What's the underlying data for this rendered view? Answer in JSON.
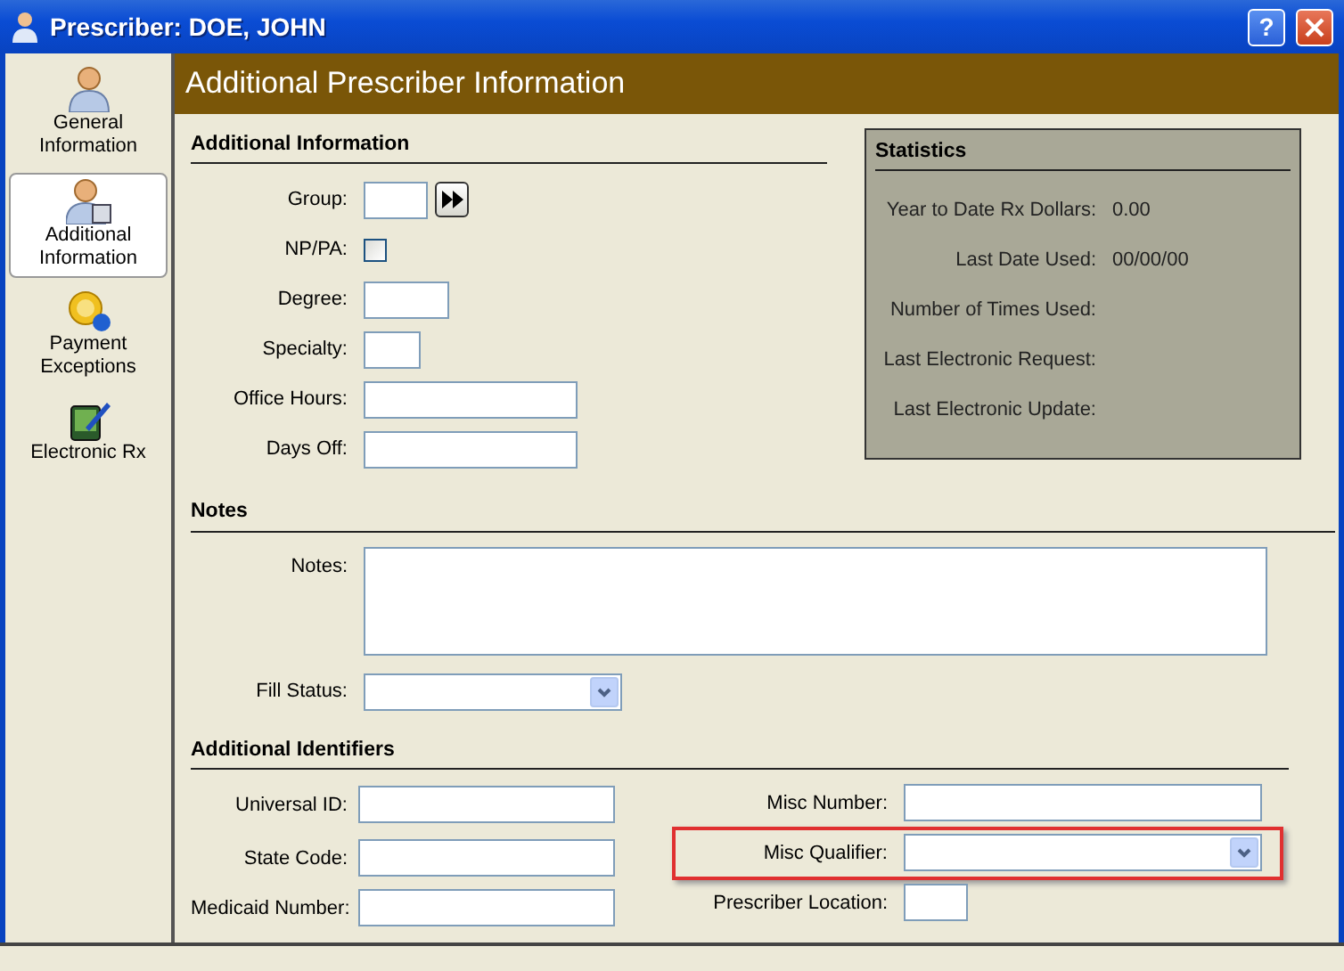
{
  "window": {
    "title": "Prescriber: DOE, JOHN",
    "help": "?"
  },
  "sidebar": {
    "items": [
      {
        "label": "General Information",
        "selected": false
      },
      {
        "label": "Additional Information",
        "selected": true
      },
      {
        "label": "Payment Exceptions",
        "selected": false
      },
      {
        "label": "Electronic Rx",
        "selected": false
      }
    ]
  },
  "header": {
    "title": "Additional Prescriber Information"
  },
  "additional_information": {
    "heading": "Additional Information",
    "fields": [
      {
        "label": "Group:",
        "kind": "text-button"
      },
      {
        "label": "NP/PA:",
        "kind": "checkbox",
        "checked": false
      },
      {
        "label": "Degree:",
        "kind": "text"
      },
      {
        "label": "Specialty:",
        "kind": "text"
      },
      {
        "label": "Office Hours:",
        "kind": "text"
      },
      {
        "label": "Days Off:",
        "kind": "text"
      }
    ]
  },
  "statistics": {
    "heading": "Statistics",
    "rows": [
      {
        "label": "Year to Date Rx Dollars:",
        "value": "0.00"
      },
      {
        "label": "Last Date Used:",
        "value": "00/00/00"
      },
      {
        "label": "Number of Times Used:"
      },
      {
        "label": "Last Electronic Request:"
      },
      {
        "label": "Last Electronic Update:"
      }
    ]
  },
  "notes": {
    "heading": "Notes",
    "fields": [
      {
        "label": "Notes:",
        "kind": "textarea"
      },
      {
        "label": "Fill Status:",
        "kind": "combo"
      }
    ]
  },
  "additional_identifiers": {
    "heading": "Additional Identifiers",
    "left_fields": [
      {
        "label": "Universal ID:",
        "kind": "text"
      },
      {
        "label": "State Code:",
        "kind": "text"
      },
      {
        "label": "Medicaid Number:",
        "kind": "text"
      }
    ],
    "right_fields": [
      {
        "label": "Misc Number:",
        "kind": "text",
        "highlighted": false
      },
      {
        "label": "Misc Qualifier:",
        "kind": "combo",
        "highlighted": true
      },
      {
        "label": "Prescriber Location:",
        "kind": "text",
        "highlighted": false
      }
    ]
  }
}
